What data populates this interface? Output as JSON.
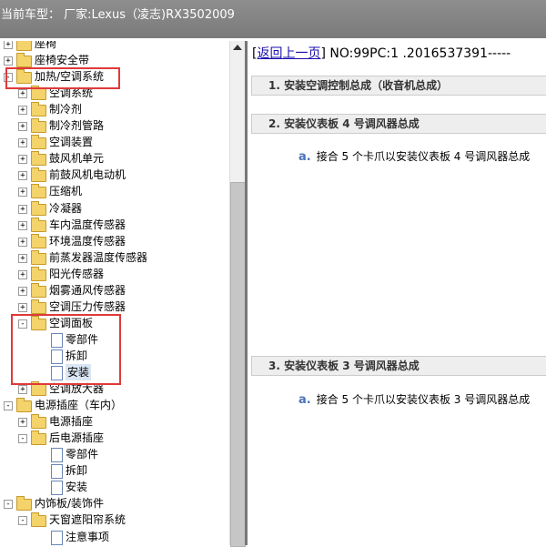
{
  "window": {
    "title": "当前车型：  厂家:Lexus（凌志)RX3502009"
  },
  "tree": {
    "items": [
      {
        "label": "座椅",
        "level": 0,
        "type": "folder",
        "expander": "+"
      },
      {
        "label": "座椅安全带",
        "level": 0,
        "type": "folder",
        "expander": "+"
      },
      {
        "label": "加热/空调系统",
        "level": 0,
        "type": "folder",
        "expander": "−"
      },
      {
        "label": "空调系统",
        "level": 1,
        "type": "folder",
        "expander": "+"
      },
      {
        "label": "制冷剂",
        "level": 1,
        "type": "folder",
        "expander": "+"
      },
      {
        "label": "制冷剂管路",
        "level": 1,
        "type": "folder",
        "expander": "+"
      },
      {
        "label": "空调装置",
        "level": 1,
        "type": "folder",
        "expander": "+"
      },
      {
        "label": "鼓风机单元",
        "level": 1,
        "type": "folder",
        "expander": "+"
      },
      {
        "label": "前鼓风机电动机",
        "level": 1,
        "type": "folder",
        "expander": "+"
      },
      {
        "label": "压缩机",
        "level": 1,
        "type": "folder",
        "expander": "+"
      },
      {
        "label": "冷凝器",
        "level": 1,
        "type": "folder",
        "expander": "+"
      },
      {
        "label": "车内温度传感器",
        "level": 1,
        "type": "folder",
        "expander": "+"
      },
      {
        "label": "环境温度传感器",
        "level": 1,
        "type": "folder",
        "expander": "+"
      },
      {
        "label": "前蒸发器温度传感器",
        "level": 1,
        "type": "folder",
        "expander": "+"
      },
      {
        "label": "阳光传感器",
        "level": 1,
        "type": "folder",
        "expander": "+"
      },
      {
        "label": "烟雾通风传感器",
        "level": 1,
        "type": "folder",
        "expander": "+"
      },
      {
        "label": "空调压力传感器",
        "level": 1,
        "type": "folder",
        "expander": "+"
      },
      {
        "label": "空调面板",
        "level": 1,
        "type": "folder",
        "expander": "−"
      },
      {
        "label": "零部件",
        "level": 2,
        "type": "page",
        "expander": ""
      },
      {
        "label": "拆卸",
        "level": 2,
        "type": "page",
        "expander": ""
      },
      {
        "label": "安装",
        "level": 2,
        "type": "page",
        "expander": "",
        "selected": true
      },
      {
        "label": "空调放大器",
        "level": 1,
        "type": "folder",
        "expander": "+"
      },
      {
        "label": "电源插座（车内）",
        "level": 0,
        "type": "folder",
        "expander": "−"
      },
      {
        "label": "电源插座",
        "level": 1,
        "type": "folder",
        "expander": "+"
      },
      {
        "label": "后电源插座",
        "level": 1,
        "type": "folder",
        "expander": "−"
      },
      {
        "label": "零部件",
        "level": 2,
        "type": "page",
        "expander": ""
      },
      {
        "label": "拆卸",
        "level": 2,
        "type": "page",
        "expander": ""
      },
      {
        "label": "安装",
        "level": 2,
        "type": "page",
        "expander": ""
      },
      {
        "label": "内饰板/装饰件",
        "level": 0,
        "type": "folder",
        "expander": "−"
      },
      {
        "label": "天窗遮阳帘系统",
        "level": 1,
        "type": "folder",
        "expander": "−"
      },
      {
        "label": "注意事项",
        "level": 2,
        "type": "page",
        "expander": ""
      }
    ]
  },
  "content": {
    "back_link": "返回上一页",
    "doc_id": " NO:99PC:1 .2016537391-----",
    "sections": [
      {
        "title": "1. 安装空调控制总成（收音机总成）"
      },
      {
        "title": "2. 安装仪表板 4 号调风器总成",
        "step_letter": "a.",
        "step_text": "接合 5 个卡爪以安装仪表板 4 号调风器总成"
      },
      {
        "title": "3. 安装仪表板 3 号调风器总成",
        "step_letter": "a.",
        "step_text": "接合 5 个卡爪以安装仪表板 3 号调风器总成"
      }
    ]
  },
  "colors": {
    "annotation_red": "#e0393a",
    "titlebar": "#858585",
    "step_letter": "#4a73b8"
  }
}
